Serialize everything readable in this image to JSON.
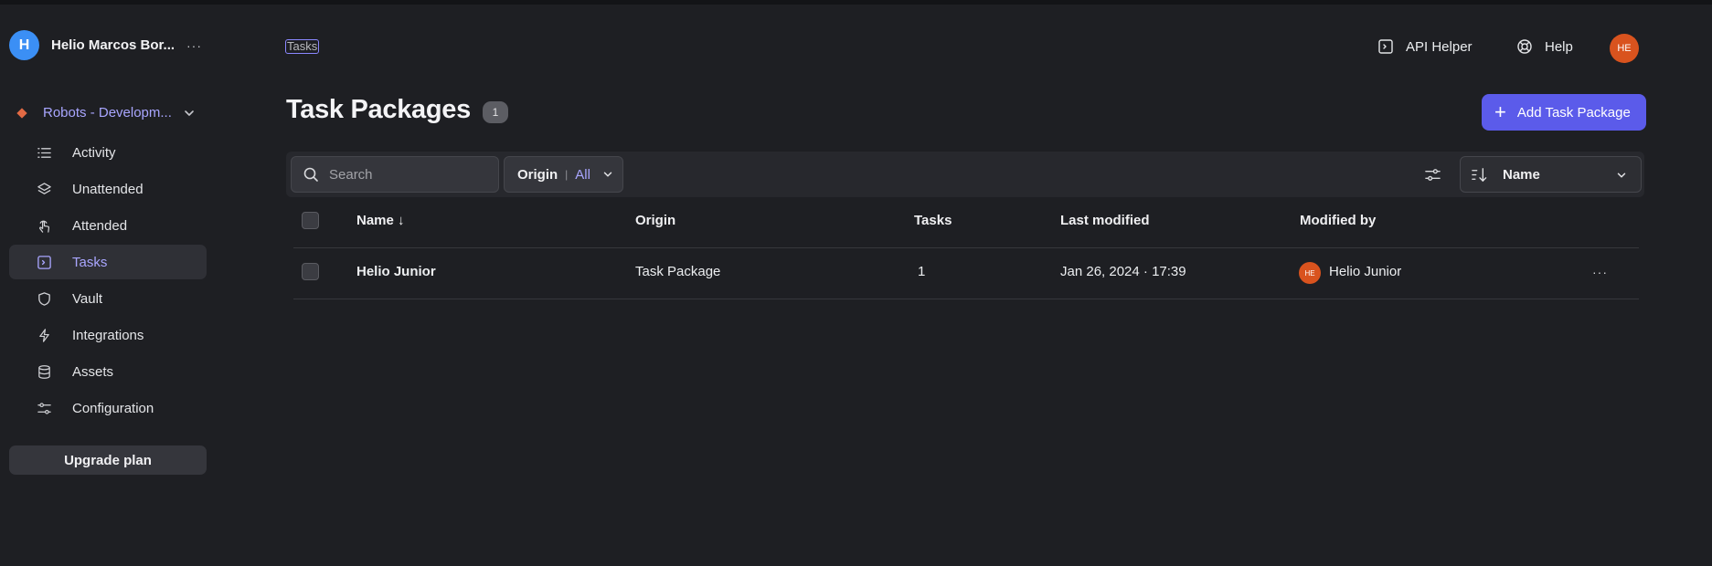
{
  "user": {
    "initial": "H",
    "name": "Helio Marcos Bor...",
    "more": "···"
  },
  "workspace": {
    "name": "Robots - Developm..."
  },
  "nav": [
    {
      "label": "Activity"
    },
    {
      "label": "Unattended"
    },
    {
      "label": "Attended"
    },
    {
      "label": "Tasks"
    },
    {
      "label": "Vault"
    },
    {
      "label": "Integrations"
    },
    {
      "label": "Assets"
    },
    {
      "label": "Configuration"
    }
  ],
  "upgrade_label": "Upgrade plan",
  "header": {
    "breadcrumb": "Tasks",
    "api_helper": "API Helper",
    "help": "Help",
    "avatar_initials": "HE"
  },
  "page": {
    "title": "Task Packages",
    "count": "1",
    "add_button": "Add Task Package"
  },
  "toolbar": {
    "search_placeholder": "Search",
    "origin_label": "Origin",
    "origin_sep": "|",
    "origin_value": "All",
    "sort_value": "Name"
  },
  "table": {
    "columns": [
      "Name ↓",
      "Origin",
      "Tasks",
      "Last modified",
      "Modified by"
    ],
    "rows": [
      {
        "name": "Helio Junior",
        "origin": "Task Package",
        "tasks": "1",
        "last_modified": "Jan 26, 2024 · 17:39",
        "modified_by_initials": "HE",
        "modified_by": "Helio Junior",
        "more": "···"
      }
    ]
  },
  "colors": {
    "background": "#1e1f23",
    "accent": "#5b5bea",
    "accent_text": "#a9a6ff",
    "avatar_orange": "#d9531e",
    "avatar_blue": "#3b8ff5"
  }
}
